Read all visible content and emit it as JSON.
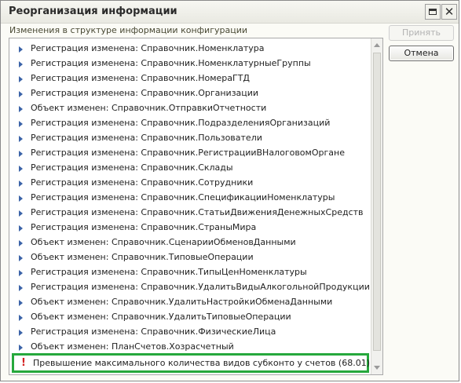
{
  "window": {
    "title": "Реорганизация информации"
  },
  "caption": "Изменения в структуре информации конфигурации",
  "buttons": {
    "accept": "Принять",
    "cancel": "Отмена"
  },
  "items": [
    "Регистрация изменена: Справочник.Номенклатура",
    "Регистрация изменена: Справочник.НоменклатурныеГруппы",
    "Регистрация изменена: Справочник.НомераГТД",
    "Регистрация изменена: Справочник.Организации",
    "Объект изменен: Справочник.ОтправкиОтчетности",
    "Регистрация изменена: Справочник.ПодразделенияОрганизаций",
    "Регистрация изменена: Справочник.Пользователи",
    "Регистрация изменена: Справочник.РегистрацииВНалоговомОргане",
    "Регистрация изменена: Справочник.Склады",
    "Регистрация изменена: Справочник.Сотрудники",
    "Регистрация изменена: Справочник.СпецификацииНоменклатуры",
    "Регистрация изменена: Справочник.СтатьиДвиженияДенежныхСредств",
    "Регистрация изменена: Справочник.СтраныМира",
    "Объект изменен: Справочник.СценарииОбменовДанными",
    "Объект изменен: Справочник.ТиповыеОперации",
    "Регистрация изменена: Справочник.ТипыЦенНоменклатуры",
    "Регистрация изменена: Справочник.УдалитьВидыАлкогольнойПродукции",
    "Объект изменен: Справочник.УдалитьНастройкиОбменаДанными",
    "Объект изменен: Справочник.УдалитьТиповыеОперации",
    "Регистрация изменена: Справочник.ФизическиеЛица",
    "Объект изменен: ПланСчетов.Хозрасчетный"
  ],
  "warning": {
    "icon": "!",
    "text": "Превышение максимального количества видов субконто у счетов (68.01)"
  }
}
